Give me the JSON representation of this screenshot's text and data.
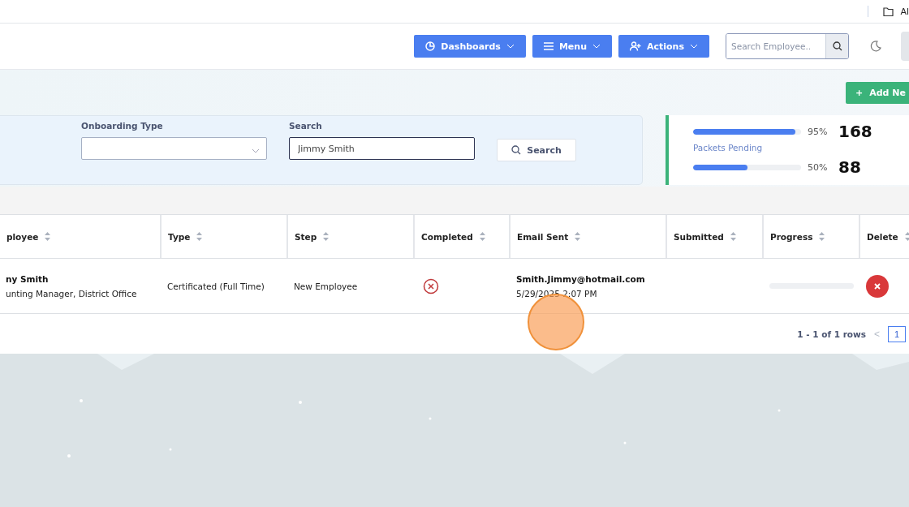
{
  "top_bar": {
    "folder_label": "Al"
  },
  "header": {
    "buttons": [
      {
        "label": "Dashboards",
        "kind": "dashboards"
      },
      {
        "label": "Menu",
        "kind": "menu"
      },
      {
        "label": "Actions",
        "kind": "actions"
      }
    ],
    "search": {
      "placeholder": "Search Employee.."
    }
  },
  "add_button": {
    "icon": "+",
    "label": "Add Ne"
  },
  "filters": [
    {
      "label": "Onboarding Type",
      "kind": "select"
    },
    {
      "label": "Search",
      "kind": "text",
      "value": "Jimmy Smith"
    }
  ],
  "search_button": "Search",
  "stats": [
    {
      "level": 0.95,
      "reading": "95%",
      "count": "168",
      "label": "Packets Pending"
    },
    {
      "level": 0.5,
      "reading": "50%",
      "count": "88"
    }
  ],
  "table": {
    "columns": [
      "ployee",
      "Type",
      "Step",
      "Completed",
      "Email Sent",
      "Submitted",
      "Progress",
      "Delete"
    ],
    "rows": [
      {
        "name": "ny Smith",
        "title": "unting Manager, District Office",
        "type": "Certificated (Full Time)",
        "step": "New Employee",
        "completed": false,
        "email": "Smith.Jimmy@hotmail.com",
        "sent": "5/29/2025 2:07 PM",
        "progress": {
          "level": 0
        }
      }
    ]
  },
  "pagination": {
    "summary": "1 - 1 of 1 rows",
    "prev": "<",
    "pages": [
      {
        "label": "1",
        "selected": true
      }
    ]
  }
}
